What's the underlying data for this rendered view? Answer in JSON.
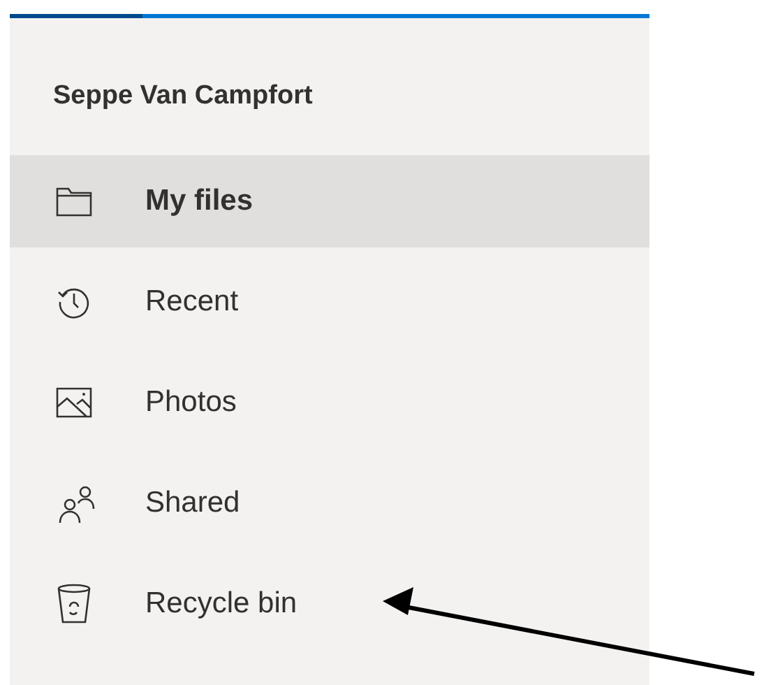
{
  "header": {
    "title": "Seppe Van Campfort"
  },
  "nav": [
    {
      "label": "My files",
      "kind": "folder",
      "selected": true
    },
    {
      "label": "Recent",
      "kind": "history",
      "selected": false
    },
    {
      "label": "Photos",
      "kind": "photo",
      "selected": false
    },
    {
      "label": "Shared",
      "kind": "people",
      "selected": false
    },
    {
      "label": "Recycle bin",
      "kind": "bin",
      "selected": false
    }
  ]
}
